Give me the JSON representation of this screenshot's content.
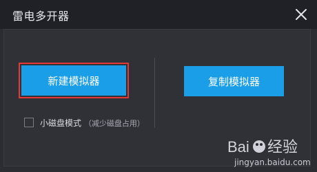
{
  "window": {
    "title": "雷电多开器"
  },
  "actions": {
    "new_emulator_label": "新建模拟器",
    "copy_emulator_label": "复制模拟器"
  },
  "option": {
    "mode_label": "小磁盘模式",
    "mode_note": "（减少磁盘占用）"
  },
  "watermark": {
    "logo_text": "Baidu经验",
    "url": "jingyan.baidu.com"
  },
  "colors": {
    "primary_button": "#1a9ee8",
    "highlight_border": "#e53935",
    "titlebar_bg": "#1f2126",
    "window_bg": "#2b2d33"
  },
  "icons": {
    "close": "close-icon",
    "checkbox": "checkbox-icon"
  }
}
